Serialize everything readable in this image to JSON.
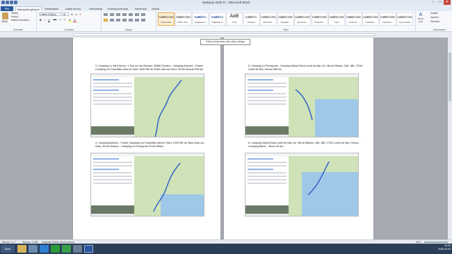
{
  "window": {
    "title": "Wakacje 2025 Fr - Microsoft Word",
    "controls": [
      "–",
      "□",
      "✕"
    ]
  },
  "ribbon_tabs": [
    "Plik",
    "Narzędzia główne",
    "Wstawianie",
    "Układ strony",
    "Odwołania",
    "Korespondencja",
    "Recenzja",
    "Widok"
  ],
  "clipboard": {
    "paste": "Wklej",
    "cut": "Wytnij",
    "copy": "Kopiuj",
    "format_painter": "Malarz formatów",
    "label": "Schowek"
  },
  "font": {
    "name": "Calibri (Tekst p",
    "size": "11",
    "label": "Czcionka",
    "buttons": [
      "B",
      "I",
      "U",
      "abc",
      "x₂",
      "x²",
      "A",
      "A"
    ]
  },
  "paragraph": {
    "label": "Akapit"
  },
  "styles": {
    "label": "Style",
    "tiles": [
      {
        "sample": "AaBbCcDc",
        "name": "¶ Normalny"
      },
      {
        "sample": "AaBbCcDc",
        "name": "¶ Bez odst..."
      },
      {
        "sample": "AaBbCc",
        "name": "Nagłówek 1"
      },
      {
        "sample": "AaBbCc",
        "name": "Nagłówek 2"
      },
      {
        "sample": "AaB",
        "name": "Tytuł"
      },
      {
        "sample": "AaBbCc.",
        "name": "Podtytuł"
      },
      {
        "sample": "AaBbCcDc",
        "name": "Wyróżnie..."
      },
      {
        "sample": "AaBbCcDc",
        "name": "Uwydatn..."
      },
      {
        "sample": "AaBbCcDc",
        "name": "Wyróżnie..."
      },
      {
        "sample": "AaBbCcDc",
        "name": "Pogrubie..."
      },
      {
        "sample": "AaBbCcDc",
        "name": "Cytat"
      },
      {
        "sample": "AaBbCcDc",
        "name": "Cytat intr..."
      },
      {
        "sample": "AaBbCcDc",
        "name": "Odwołani..."
      },
      {
        "sample": "AaBbCcDc",
        "name": "Odwołani..."
      },
      {
        "sample": "AaBbCcDc",
        "name": "Tytuł książki"
      }
    ],
    "change_styles": "Zmień style"
  },
  "editing": {
    "find": "Znajdź",
    "replace": "Zamień",
    "select": "Zaznacz",
    "label": "Edytowanie"
  },
  "tooltip": "Kliknij dwukrotnie, aby ukryć odstęp",
  "page_left": {
    "item3": "3.    Camping Le Val d'Amour, 1 Rue du Val d'Amour, 39380 Ounans - Camping Ambuez - Flower Camping Les Fauvettes dans le Gard, 1030 Rte de Saint-Jean-du-Gard, 30140 Anduze 600 km",
    "item4": "4.    Camping Ambuez - Flower Camping Les Fauvettes dans le Gard, 1030 Rte de Saint-Jean-du-Gard, 30140 Anduze - Camping La Pomeyrole 20.06 399km"
  },
  "page_right": {
    "item5": "5.    Camping Le Pomeyrole - Camping Santa Elena Lloret de Mar, Av. Vila de Blanes, 186, 188, 17310 Lloret de Mar, Girona 366 km",
    "item6": "6.    Camping Santa Elena Lloret de Mar, Av. Vila de Blanes, 186, 188, 17310 Lloret de Mar, Girona - Camping Barcé - Jihoa 130 km"
  },
  "statusbar": {
    "page": "Strona: 1 z 7",
    "words": "Wyrazy: 1 098",
    "language": "Angielski (Stany Zjednoczone)",
    "zoom": "60%"
  },
  "taskbar": {
    "start": "Start",
    "time": "09:09",
    "date": "2025-06-09"
  },
  "colors": {
    "accent": "#2b579a",
    "route": "#3465c8",
    "taskbar": "#2c3e57"
  }
}
